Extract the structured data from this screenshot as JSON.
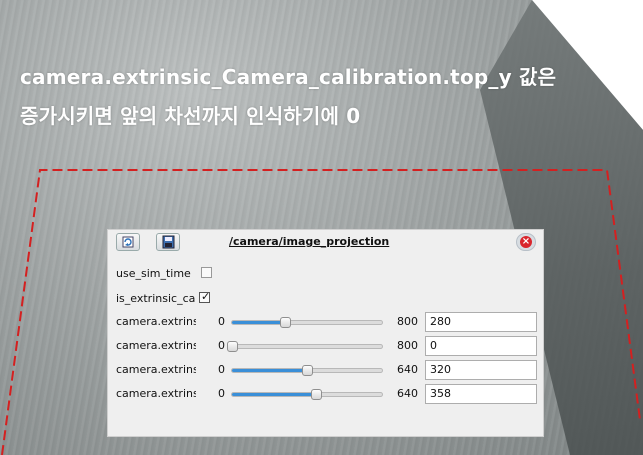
{
  "caption": {
    "line1": "camera.extrinsic_Camera_calibration.top_y 값은",
    "line2": "증가시키면 앞의 차선까지 인식하기에 0"
  },
  "dialog": {
    "title": "/camera/image_projection",
    "close_glyph": "×",
    "params": {
      "use_sim_time": {
        "label": "use_sim_time",
        "checked": false
      },
      "is_extrinsic": {
        "label": "is_extrinsic_cai",
        "checked": true,
        "check_glyph": "✓"
      }
    },
    "sliders": [
      {
        "label": "camera.extrins",
        "min": "0",
        "max": "800",
        "value": "280",
        "fraction": 0.35
      },
      {
        "label": "camera.extrins",
        "min": "0",
        "max": "800",
        "value": "0",
        "fraction": 0.0
      },
      {
        "label": "camera.extrins",
        "min": "0",
        "max": "640",
        "value": "320",
        "fraction": 0.5
      },
      {
        "label": "camera.extrins",
        "min": "0",
        "max": "640",
        "value": "358",
        "fraction": 0.559
      }
    ]
  },
  "colors": {
    "roi_line": "#d42020",
    "slider_fill": "#3a8fd8",
    "close": "#d9262d"
  }
}
